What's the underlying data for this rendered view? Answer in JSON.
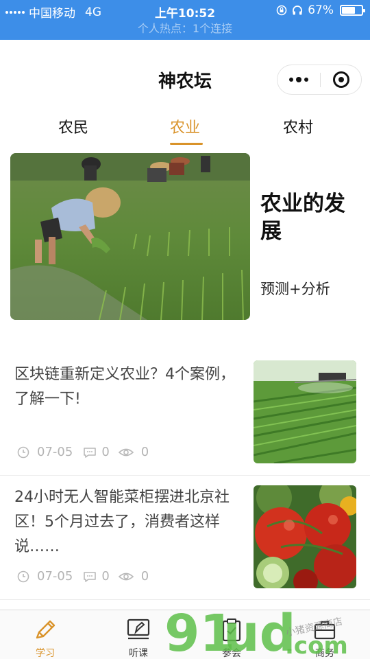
{
  "status_bar": {
    "carrier": "中国移动",
    "network": "4G",
    "time": "上午10:52",
    "battery": "67%",
    "battery_level": 0.67,
    "hotspot": "个人热点：1个连接"
  },
  "nav": {
    "title": "神农坛"
  },
  "tabs": [
    {
      "label": "农民",
      "active": false
    },
    {
      "label": "农业",
      "active": true
    },
    {
      "label": "农村",
      "active": false
    }
  ],
  "featured": {
    "title": "农业的发展",
    "subtitle": "预测+分析"
  },
  "articles": [
    {
      "title": "区块链重新定义农业？4个案例，了解一下!",
      "date": "07-05",
      "comments": "0",
      "views": "0"
    },
    {
      "title": "24小时无人智能菜柜摆进北京社区！5个月过去了，消费者这样说……",
      "date": "07-05",
      "comments": "0",
      "views": "0"
    }
  ],
  "tabbar": [
    {
      "label": "学习",
      "icon": "pencil-icon",
      "active": true
    },
    {
      "label": "听课",
      "icon": "lecture-icon",
      "active": false
    },
    {
      "label": "参会",
      "icon": "clipboard-icon",
      "active": false
    },
    {
      "label": "商务",
      "icon": "briefcase-icon",
      "active": false
    }
  ],
  "colors": {
    "status_bar": "#3d8ee8",
    "accent": "#d9932a"
  },
  "watermark": {
    "logo": "91ud.com",
    "tagline": "小猪资源商店"
  }
}
